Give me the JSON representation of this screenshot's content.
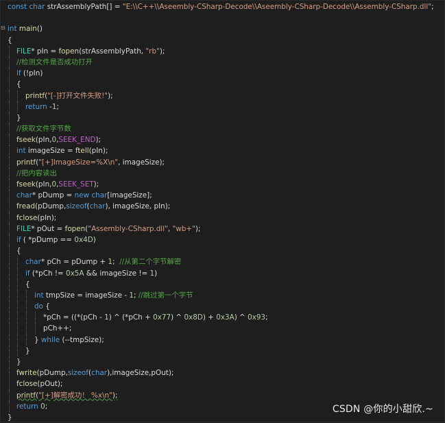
{
  "editor": {
    "lines": [
      {
        "indent": 0,
        "fold": "",
        "tokens": [
          [
            "kw",
            "const "
          ],
          [
            "kw",
            "char "
          ],
          [
            "id",
            "strAssemblyPath[] = "
          ],
          [
            "st",
            "\"E:\\\\C++\\\\Aseembly-CSharp-Decode\\\\Aseembly-CSharp-Decode\\\\Assembly-CSharp.dll\""
          ],
          [
            "id",
            ";"
          ]
        ]
      },
      {
        "indent": 0,
        "fold": "",
        "tokens": []
      },
      {
        "indent": 0,
        "fold": "⊟",
        "tokens": [
          [
            "kw",
            "int "
          ],
          [
            "fn",
            "main"
          ],
          [
            "id",
            "()"
          ]
        ]
      },
      {
        "indent": 0,
        "fold": "",
        "tokens": [
          [
            "id",
            "{"
          ]
        ]
      },
      {
        "indent": 1,
        "fold": "",
        "tokens": [
          [
            "tp",
            "FILE"
          ],
          [
            "id",
            "* pIn = "
          ],
          [
            "fn",
            "fopen"
          ],
          [
            "id",
            "(strAssemblyPath, "
          ],
          [
            "st",
            "\"rb\""
          ],
          [
            "id",
            ");"
          ]
        ]
      },
      {
        "indent": 1,
        "fold": "",
        "tokens": [
          [
            "cm",
            "//检测文件是否成功打开"
          ]
        ]
      },
      {
        "indent": 1,
        "fold": "",
        "tokens": [
          [
            "kw",
            "if "
          ],
          [
            "id",
            "(!pIn)"
          ]
        ]
      },
      {
        "indent": 1,
        "fold": "",
        "tokens": [
          [
            "id",
            "{"
          ]
        ]
      },
      {
        "indent": 2,
        "fold": "",
        "tokens": [
          [
            "fn",
            "printf"
          ],
          [
            "id",
            "("
          ],
          [
            "st",
            "\"[-]打开文件失败!\""
          ],
          [
            "id",
            ");"
          ]
        ]
      },
      {
        "indent": 2,
        "fold": "",
        "tokens": [
          [
            "kw",
            "return "
          ],
          [
            "id",
            "-"
          ],
          [
            "nm",
            "1"
          ],
          [
            "id",
            ";"
          ]
        ]
      },
      {
        "indent": 1,
        "fold": "",
        "tokens": [
          [
            "id",
            "}"
          ]
        ]
      },
      {
        "indent": 1,
        "fold": "",
        "tokens": [
          [
            "cm",
            "//获取文件字节数"
          ]
        ]
      },
      {
        "indent": 1,
        "fold": "",
        "tokens": [
          [
            "fn",
            "fseek"
          ],
          [
            "id",
            "(pIn,"
          ],
          [
            "nm",
            "0"
          ],
          [
            "id",
            ","
          ],
          [
            "mc",
            "SEEK_END"
          ],
          [
            "id",
            ");"
          ]
        ]
      },
      {
        "indent": 1,
        "fold": "",
        "tokens": [
          [
            "kw",
            "int "
          ],
          [
            "id",
            "imageSize = "
          ],
          [
            "fn",
            "ftell"
          ],
          [
            "id",
            "(pIn);"
          ]
        ]
      },
      {
        "indent": 1,
        "fold": "",
        "tokens": [
          [
            "fn",
            "printf"
          ],
          [
            "id",
            "("
          ],
          [
            "st",
            "\"[+]ImageSize=%X\\n\""
          ],
          [
            "id",
            ", imageSize);"
          ]
        ]
      },
      {
        "indent": 1,
        "fold": "",
        "tokens": [
          [
            "cm",
            "//把内容读出"
          ]
        ]
      },
      {
        "indent": 1,
        "fold": "",
        "tokens": [
          [
            "fn",
            "fseek"
          ],
          [
            "id",
            "(pIn,"
          ],
          [
            "nm",
            "0"
          ],
          [
            "id",
            ","
          ],
          [
            "mc",
            "SEEK_SET"
          ],
          [
            "id",
            ");"
          ]
        ]
      },
      {
        "indent": 1,
        "fold": "",
        "tokens": [
          [
            "kw",
            "char"
          ],
          [
            "id",
            "* pDump = "
          ],
          [
            "kw",
            "new "
          ],
          [
            "kw",
            "char"
          ],
          [
            "id",
            "[imageSize];"
          ]
        ]
      },
      {
        "indent": 1,
        "fold": "",
        "tokens": [
          [
            "fn",
            "fread"
          ],
          [
            "id",
            "(pDump,"
          ],
          [
            "kw",
            "sizeof"
          ],
          [
            "id",
            "("
          ],
          [
            "kw",
            "char"
          ],
          [
            "id",
            "), imageSize, pIn);"
          ]
        ]
      },
      {
        "indent": 1,
        "fold": "",
        "tokens": [
          [
            "fn",
            "fclose"
          ],
          [
            "id",
            "(pIn);"
          ]
        ]
      },
      {
        "indent": 1,
        "fold": "",
        "tokens": [
          [
            "tp",
            "FILE"
          ],
          [
            "id",
            "* pOut = "
          ],
          [
            "fn",
            "fopen"
          ],
          [
            "id",
            "("
          ],
          [
            "st",
            "\"Assembly-CSharp.dll\""
          ],
          [
            "id",
            ", "
          ],
          [
            "st",
            "\"wb+\""
          ],
          [
            "id",
            ");"
          ]
        ]
      },
      {
        "indent": 1,
        "fold": "",
        "tokens": [
          [
            "kw",
            "if "
          ],
          [
            "id",
            "( *pDump == "
          ],
          [
            "nm",
            "0x4D"
          ],
          [
            "id",
            ")"
          ]
        ]
      },
      {
        "indent": 1,
        "fold": "",
        "tokens": [
          [
            "id",
            "{"
          ]
        ]
      },
      {
        "indent": 2,
        "fold": "",
        "tokens": [
          [
            "kw",
            "char"
          ],
          [
            "id",
            "* pCh = pDump + "
          ],
          [
            "nm",
            "1"
          ],
          [
            "id",
            ";  "
          ],
          [
            "cm",
            "//从第二个字节解密"
          ]
        ]
      },
      {
        "indent": 2,
        "fold": "",
        "tokens": [
          [
            "kw",
            "if "
          ],
          [
            "id",
            "(*pCh != "
          ],
          [
            "nm",
            "0x5A"
          ],
          [
            "id",
            " && imageSize != "
          ],
          [
            "nm",
            "1"
          ],
          [
            "id",
            ")"
          ]
        ]
      },
      {
        "indent": 2,
        "fold": "",
        "tokens": [
          [
            "id",
            "{"
          ]
        ]
      },
      {
        "indent": 3,
        "fold": "",
        "tokens": [
          [
            "kw",
            "int "
          ],
          [
            "id",
            "tmpSize = imageSize - "
          ],
          [
            "nm",
            "1"
          ],
          [
            "id",
            "; "
          ],
          [
            "cm",
            "//跳过第一个字节"
          ]
        ]
      },
      {
        "indent": 3,
        "fold": "",
        "tokens": [
          [
            "kw",
            "do "
          ],
          [
            "id",
            "{"
          ]
        ]
      },
      {
        "indent": 4,
        "fold": "",
        "tokens": [
          [
            "id",
            "*pCh = ((*(pCh - "
          ],
          [
            "nm",
            "1"
          ],
          [
            "id",
            ") ^ (*pCh + "
          ],
          [
            "nm",
            "0x77"
          ],
          [
            "id",
            ") ^ "
          ],
          [
            "nm",
            "0x8D"
          ],
          [
            "id",
            ") + "
          ],
          [
            "nm",
            "0x3A"
          ],
          [
            "id",
            ") ^ "
          ],
          [
            "nm",
            "0x93"
          ],
          [
            "id",
            ";"
          ]
        ]
      },
      {
        "indent": 4,
        "fold": "",
        "tokens": [
          [
            "id",
            "pCh++;"
          ]
        ]
      },
      {
        "indent": 3,
        "fold": "",
        "tokens": [
          [
            "id",
            "} "
          ],
          [
            "kw",
            "while "
          ],
          [
            "id",
            "(--tmpSize);"
          ]
        ]
      },
      {
        "indent": 2,
        "fold": "",
        "tokens": [
          [
            "id",
            "}"
          ]
        ]
      },
      {
        "indent": 1,
        "fold": "",
        "tokens": [
          [
            "id",
            "}"
          ]
        ]
      },
      {
        "indent": 1,
        "fold": "",
        "tokens": [
          [
            "fn",
            "fwrite"
          ],
          [
            "id",
            "(pDump,"
          ],
          [
            "kw",
            "sizeof"
          ],
          [
            "id",
            "("
          ],
          [
            "kw",
            "char"
          ],
          [
            "id",
            "),imageSize,pOut);"
          ]
        ]
      },
      {
        "indent": 1,
        "fold": "",
        "tokens": [
          [
            "fn",
            "fclose"
          ],
          [
            "id",
            "(pOut);"
          ]
        ]
      },
      {
        "indent": 1,
        "fold": "",
        "squiggle": true,
        "tokens": [
          [
            "fn",
            "printf"
          ],
          [
            "id",
            "("
          ],
          [
            "st",
            "\"[+]解密成功！ %x\\n\""
          ],
          [
            "id",
            ");"
          ]
        ]
      },
      {
        "indent": 1,
        "fold": "",
        "tokens": [
          [
            "kw",
            "return "
          ],
          [
            "nm",
            "0"
          ],
          [
            "id",
            ";"
          ]
        ]
      },
      {
        "indent": 0,
        "fold": "",
        "tokens": [
          [
            "id",
            "}"
          ]
        ]
      }
    ]
  },
  "watermark": "CSDN @你的小甜欣.~"
}
